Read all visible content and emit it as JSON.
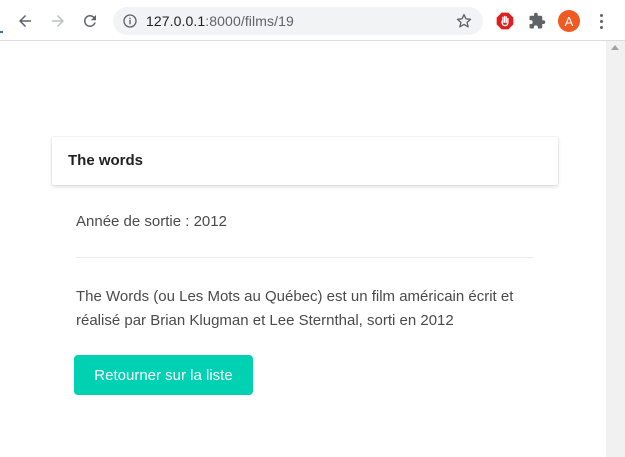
{
  "browser": {
    "url_host": "127.0.0.1",
    "url_path": ":8000/films/19",
    "avatar_letter": "A"
  },
  "film": {
    "title": "The words",
    "year_line": "Année de sortie : 2012",
    "description": "The Words (ou Les Mots au Québec) est un film américain écrit et réalisé par Brian Klugman et Lee Sternthal, sorti en 2012"
  },
  "actions": {
    "back_label": "Retourner sur la liste"
  },
  "colors": {
    "primary_button": "#00d1b2",
    "avatar": "#f05a22"
  }
}
